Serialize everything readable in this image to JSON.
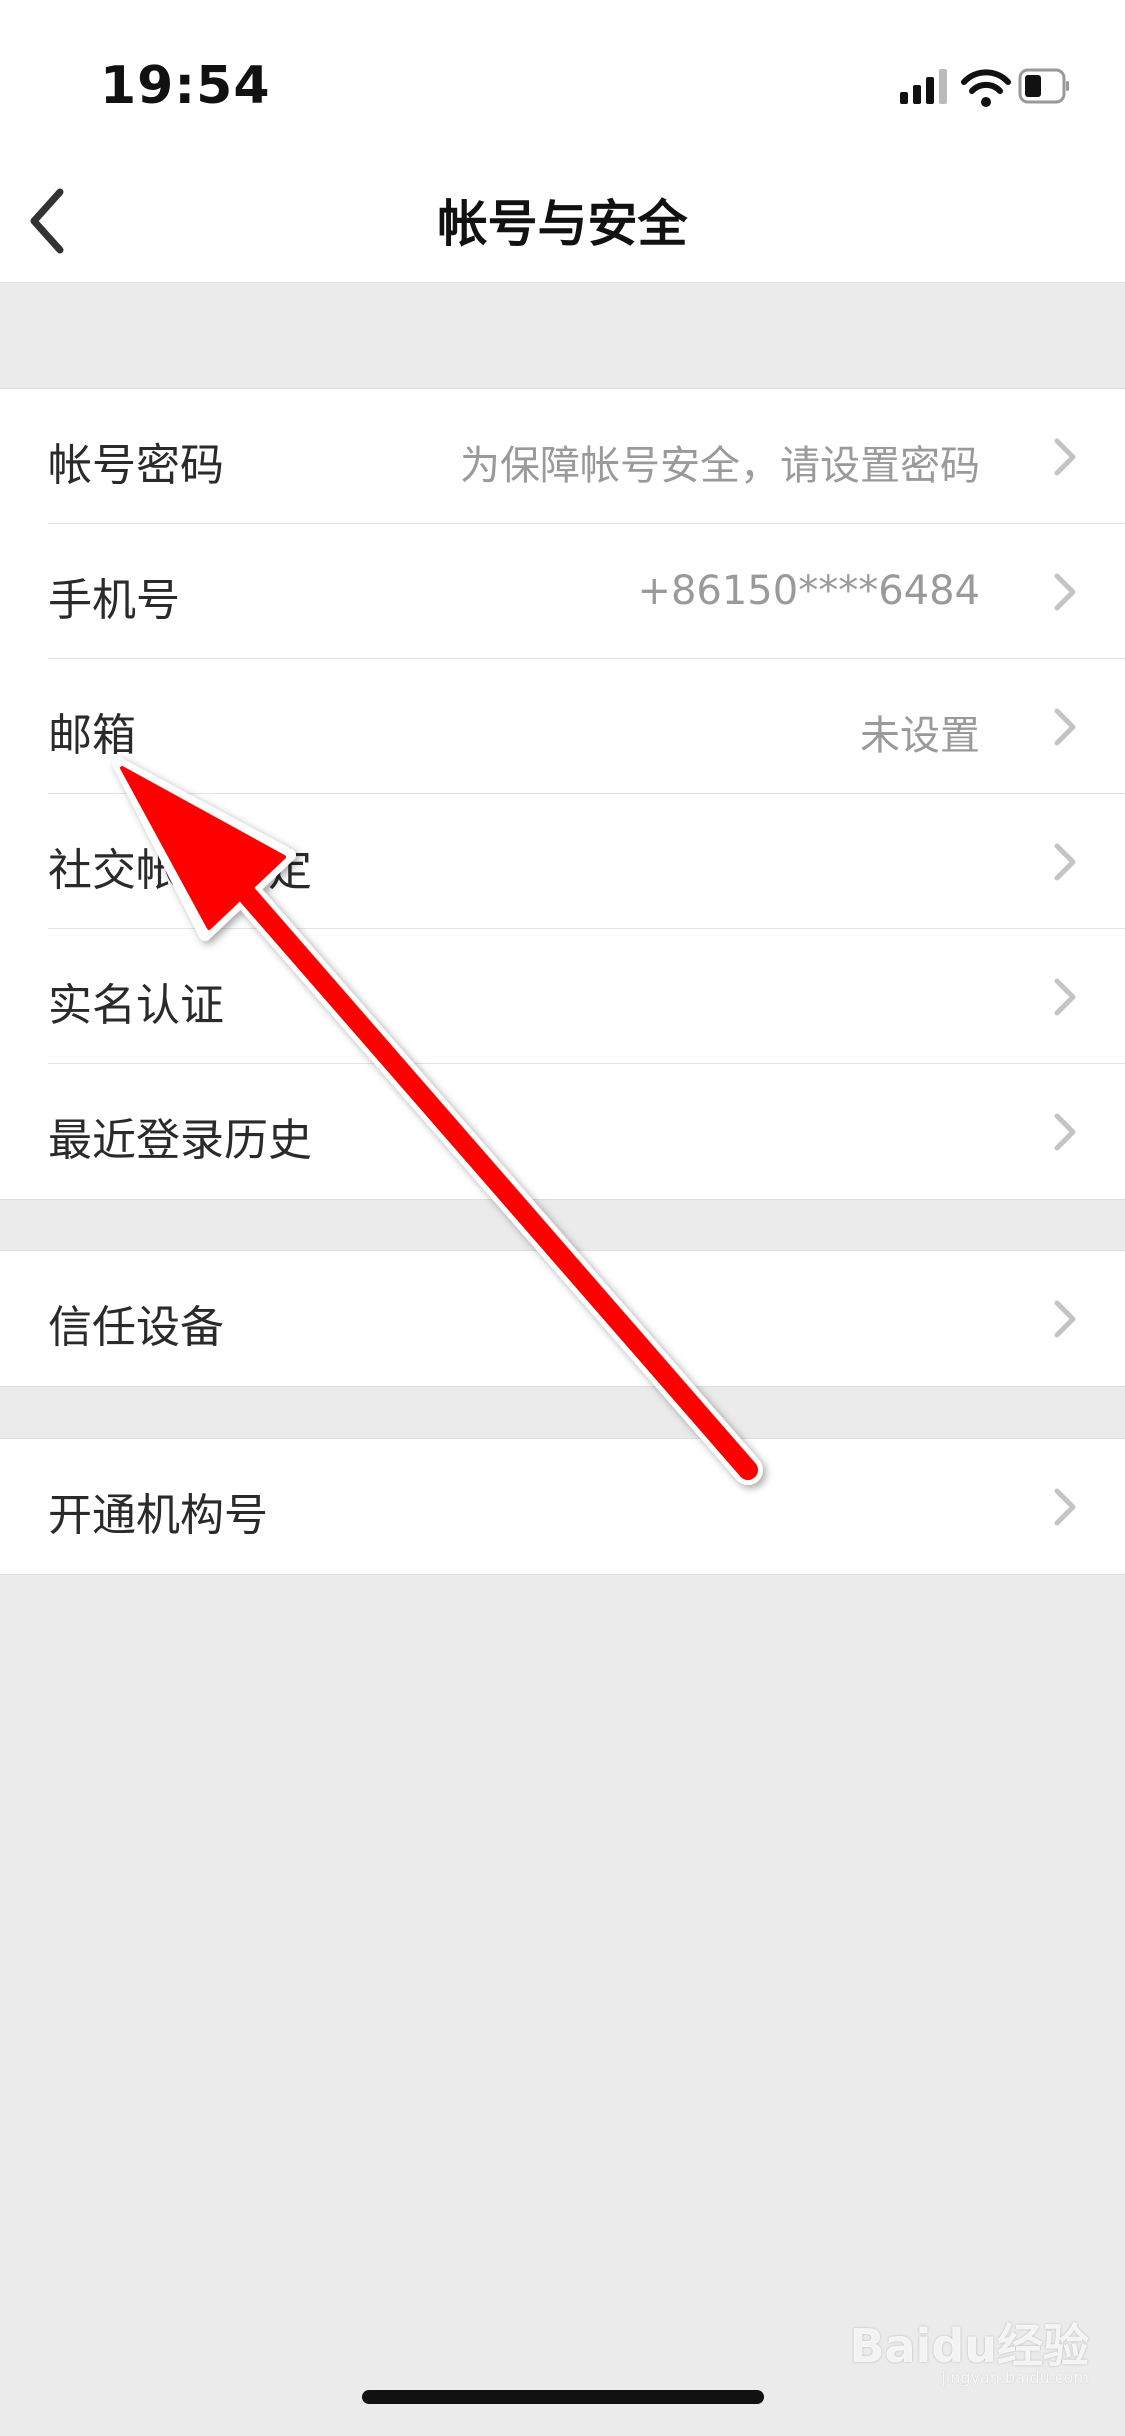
{
  "status_bar": {
    "time": "19:54",
    "icons": [
      "signal-icon",
      "wifi-icon",
      "battery-icon"
    ]
  },
  "nav": {
    "back_icon": "chevron-left-icon",
    "title": "帐号与安全"
  },
  "groups": [
    {
      "rows": [
        {
          "label": "帐号密码",
          "value": "为保障帐号安全，请设置密码"
        },
        {
          "label": "手机号",
          "value": "+86150****6484"
        },
        {
          "label": "邮箱",
          "value": "未设置"
        },
        {
          "label": "社交帐号绑定",
          "value": ""
        },
        {
          "label": "实名认证",
          "value": ""
        },
        {
          "label": "最近登录历史",
          "value": ""
        }
      ]
    },
    {
      "rows": [
        {
          "label": "信任设备",
          "value": ""
        }
      ]
    },
    {
      "rows": [
        {
          "label": "开通机构号",
          "value": ""
        }
      ]
    }
  ],
  "watermark": {
    "brand": "Baidu经验",
    "url": "jingyan.baidu.com"
  },
  "colors": {
    "background": "#ebebeb",
    "row_bg": "#ffffff",
    "value_text": "#9a9a9a",
    "annotation_arrow": "#ff0000"
  }
}
